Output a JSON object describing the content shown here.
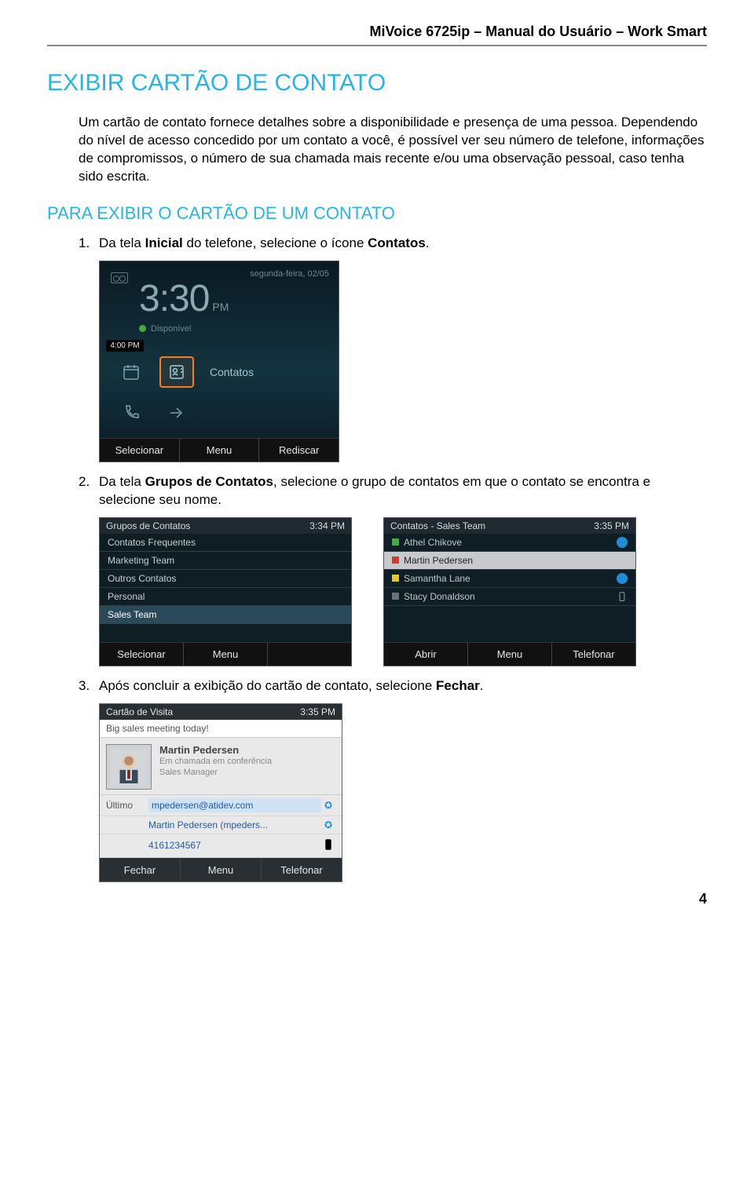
{
  "header": {
    "title": "MiVoice 6725ip – Manual do Usuário – Work Smart"
  },
  "section": {
    "title": "EXIBIR CARTÃO DE CONTATO"
  },
  "intro": "Um cartão de contato fornece detalhes sobre a disponibilidade e presença de uma pessoa. Dependendo do nível de acesso concedido por um contato a você, é possível ver seu número de telefone, informações de compromissos, o número de sua chamada mais recente e/ou uma observação pessoal, caso tenha sido escrita.",
  "subsection": {
    "title": "PARA EXIBIR O CARTÃO DE UM CONTATO"
  },
  "steps": [
    {
      "num": "1.",
      "prefix": "Da tela ",
      "bold1": "Inicial",
      "mid": " do telefone, selecione o ícone ",
      "bold2": "Contatos",
      "suffix": "."
    },
    {
      "num": "2.",
      "prefix": "Da tela ",
      "bold1": "Grupos de Contatos",
      "mid": ", selecione o grupo de contatos em que o contato se encontra e selecione seu nome.",
      "bold2": "",
      "suffix": ""
    },
    {
      "num": "3.",
      "prefix": "Após concluir a exibição do cartão de contato, selecione ",
      "bold1": "Fechar",
      "mid": ".",
      "bold2": "",
      "suffix": ""
    }
  ],
  "home_screen": {
    "date": "segunda-feira, 02/05",
    "time": "3:30",
    "ampm": "PM",
    "presence": "Disponível",
    "chip": "4:00 PM",
    "icon_label": "Contatos",
    "softkeys": [
      "Selecionar",
      "Menu",
      "Rediscar"
    ]
  },
  "groups_screen": {
    "title": "Grupos de Contatos",
    "time": "3:34 PM",
    "items": [
      "Contatos Frequentes",
      "Marketing Team",
      "Outros Contatos",
      "Personal",
      "Sales Team"
    ],
    "selected_index": 4,
    "softkeys": [
      "Selecionar",
      "Menu",
      ""
    ]
  },
  "contacts_screen": {
    "title": "Contatos - Sales Team",
    "time": "3:35 PM",
    "items": [
      {
        "name": "Athel Chikove",
        "presence": "green",
        "status": "badge"
      },
      {
        "name": "Martin Pedersen",
        "presence": "red",
        "status": ""
      },
      {
        "name": "Samantha Lane",
        "presence": "yellow",
        "status": "badge"
      },
      {
        "name": "Stacy Donaldson",
        "presence": "gray",
        "status": "phone"
      }
    ],
    "selected_index": 1,
    "softkeys": [
      "Abrir",
      "Menu",
      "Telefonar"
    ]
  },
  "card_screen": {
    "title": "Cartão de Visita",
    "time": "3:35 PM",
    "note": "Big sales meeting today!",
    "name": "Martin Pedersen",
    "status_line": "Em chamada em conferência",
    "role": "Sales Manager",
    "rows": [
      {
        "label": "Último",
        "value": "mpedersen@atidev.com",
        "tail": "badge",
        "selected": true
      },
      {
        "label": "",
        "value": "Martin Pedersen (mpeders...",
        "tail": "badge",
        "selected": false
      },
      {
        "label": "",
        "value": "4161234567",
        "tail": "phone",
        "selected": false
      }
    ],
    "softkeys": [
      "Fechar",
      "Menu",
      "Telefonar"
    ]
  },
  "page_number": "4"
}
